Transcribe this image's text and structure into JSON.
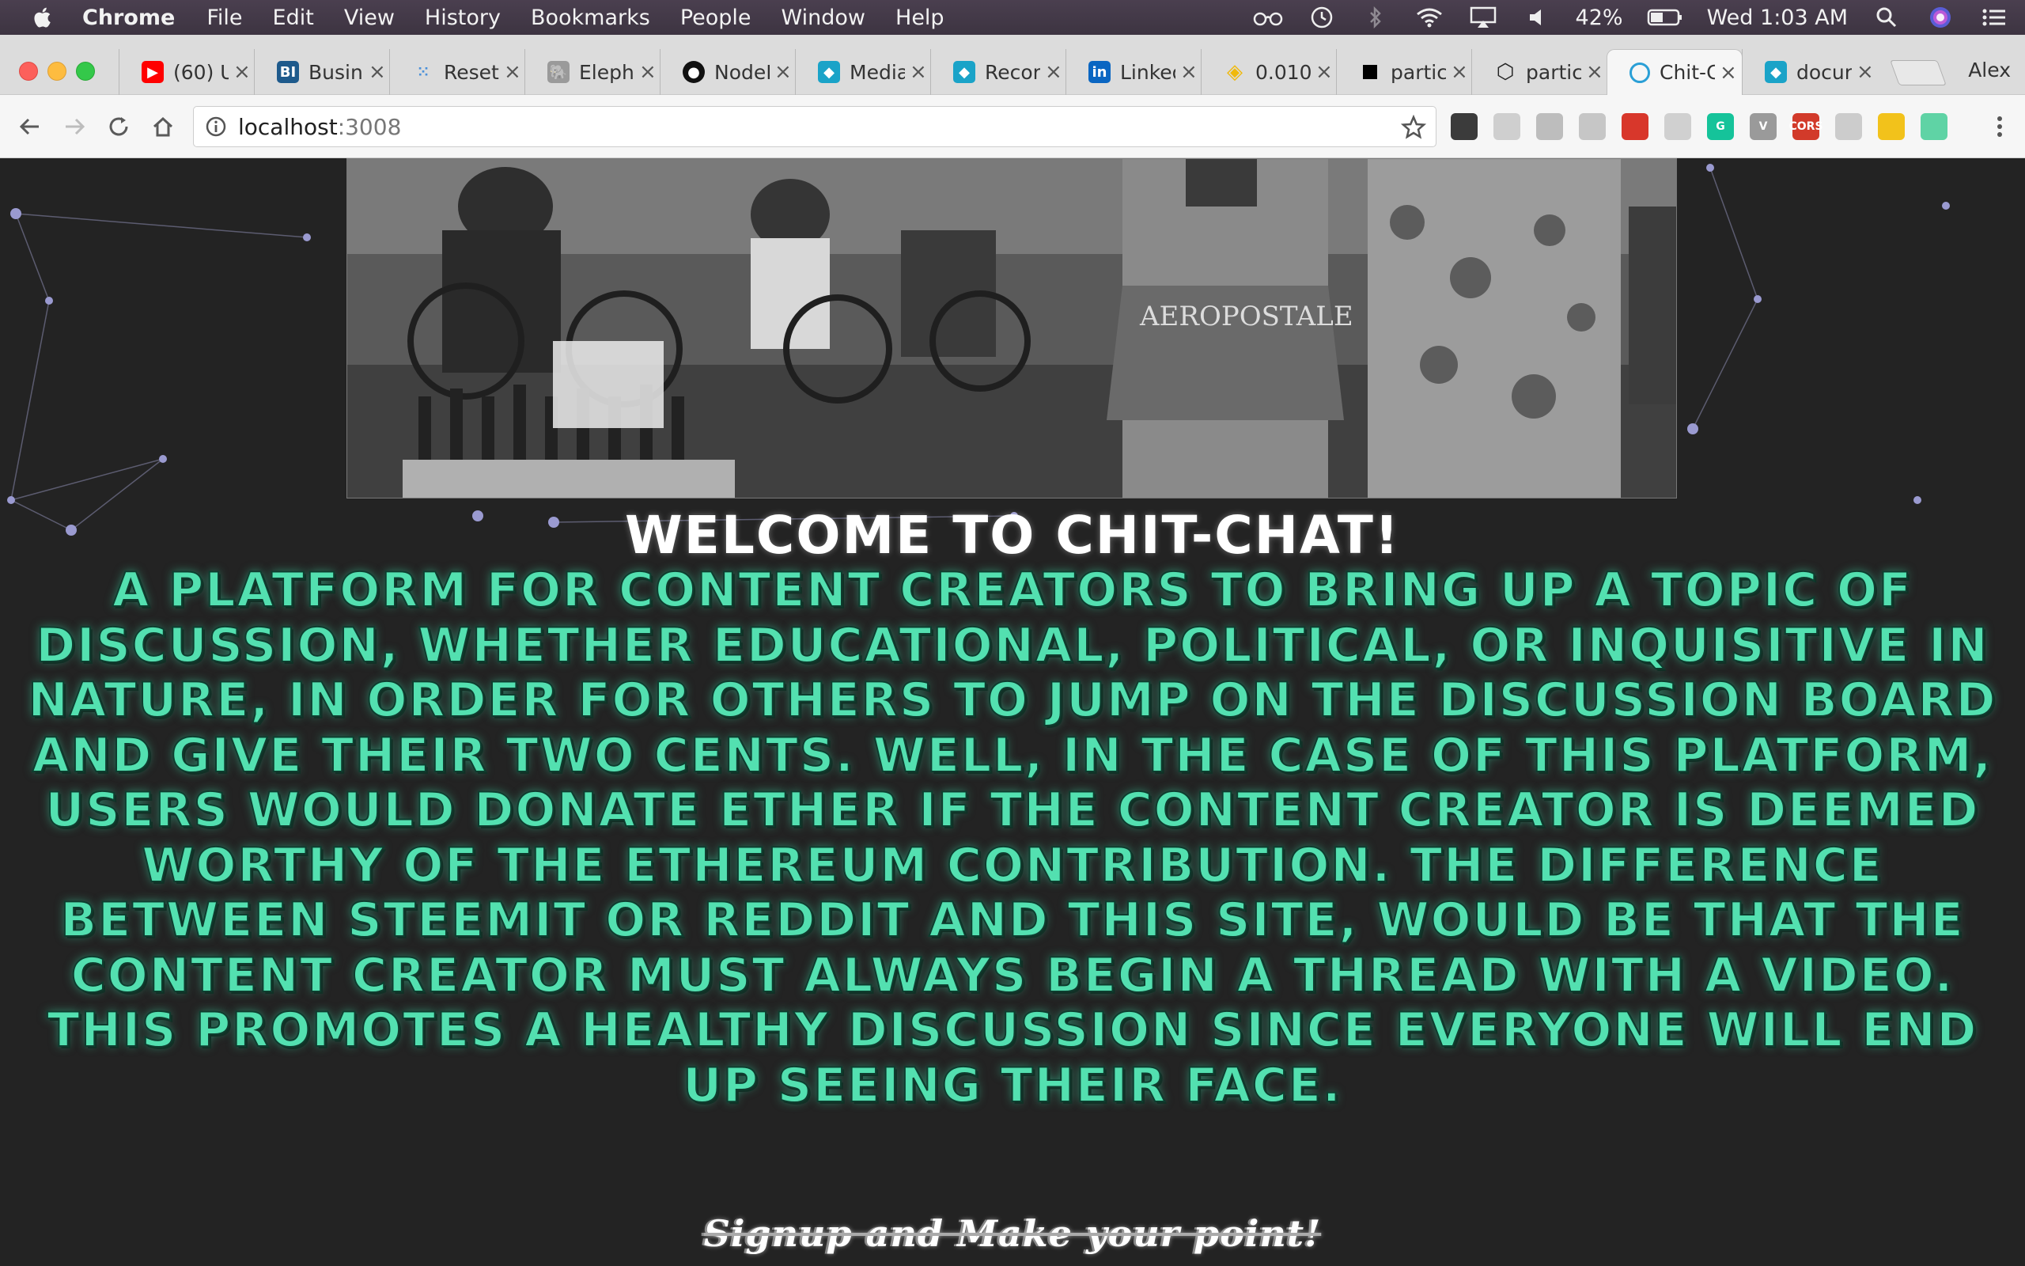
{
  "menubar": {
    "app_name": "Chrome",
    "items": [
      "File",
      "Edit",
      "View",
      "History",
      "Bookmarks",
      "People",
      "Window",
      "Help"
    ],
    "battery": "42%",
    "clock": "Wed 1:03 AM"
  },
  "browser": {
    "tabs": [
      {
        "title": "(60) U",
        "icon": "youtube-icon",
        "color": "#ff0000"
      },
      {
        "title": "Busin",
        "icon": "business-insider-icon",
        "color": "#1e5a8c"
      },
      {
        "title": "Reset",
        "icon": "dots-grid-icon",
        "color": "#4a90d9"
      },
      {
        "title": "Eleph",
        "icon": "elephant-icon",
        "color": "#777777"
      },
      {
        "title": "NodeI",
        "icon": "github-icon",
        "color": "#111111"
      },
      {
        "title": "Media",
        "icon": "panther-icon",
        "color": "#1aa3c8"
      },
      {
        "title": "Recor",
        "icon": "panther-icon",
        "color": "#1aa3c8"
      },
      {
        "title": "Linked",
        "icon": "linkedin-icon",
        "color": "#0a66c2"
      },
      {
        "title": "0.010",
        "icon": "binance-icon",
        "color": "#f0b90b"
      },
      {
        "title": "partic",
        "icon": "square-icon",
        "color": "#000000"
      },
      {
        "title": "partic",
        "icon": "codepen-icon",
        "color": "#222222"
      },
      {
        "title": "Chit-C",
        "icon": "chit-chat-icon",
        "color": "#2a9fd6",
        "active": true
      },
      {
        "title": "docur",
        "icon": "panther-icon",
        "color": "#1aa3c8"
      }
    ],
    "profile_name": "Alex",
    "url_host": "localhost",
    "url_port": ":3008",
    "extensions": [
      {
        "name": "ghostery-icon",
        "color": "#3b3b3b",
        "label": ""
      },
      {
        "name": "tree-icon",
        "color": "#cfcfcf",
        "label": ""
      },
      {
        "name": "skype-icon",
        "color": "#bdbdbd",
        "label": ""
      },
      {
        "name": "rss-icon",
        "color": "#c6c6c6",
        "label": ""
      },
      {
        "name": "pet-icon",
        "color": "#d8372b",
        "label": ""
      },
      {
        "name": "window-icon",
        "color": "#d0d0d0",
        "label": ""
      },
      {
        "name": "grammarly-icon",
        "color": "#15c39a",
        "label": "G"
      },
      {
        "name": "vue-devtools-icon",
        "color": "#9a9a9a",
        "label": "V"
      },
      {
        "name": "cors-icon",
        "color": "#d23a2a",
        "label": "CORS"
      },
      {
        "name": "screen-icon",
        "color": "#cccccc",
        "label": ""
      },
      {
        "name": "moon-icon",
        "color": "#f2c21b",
        "label": ""
      },
      {
        "name": "circle-icon",
        "color": "#5fd3a5",
        "label": ""
      }
    ]
  },
  "page": {
    "welcome": "Welcome to Chit-Chat!",
    "description": "A platform for content creators to bring up a topic of discussion, whether educational, political, or inquisitive in nature, in order for others to jump on the discussion board and give their two cents. Well, in the case of this platform, users would donate ether if the content creator is deemed worthy of the ethereum contribution. The difference between steemit or reddit and this site, would be that the content creator must always begin a thread with a video. This promotes a healthy discussion since everyone will end up seeing their face.",
    "cta": "Signup and Make your point!",
    "hero_shirt_text": "AEROPOSTALE"
  },
  "colors": {
    "page_bg": "#232323",
    "accent_text": "#53e0b0"
  }
}
